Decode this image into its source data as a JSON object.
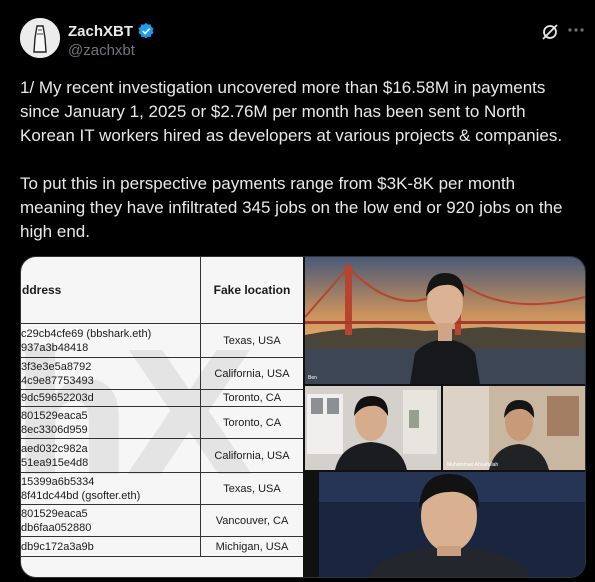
{
  "author": {
    "display_name": "ZachXBT",
    "handle": "@zachxbt",
    "verified": true
  },
  "icons": {
    "verified": "verified-badge-icon",
    "grok": "grok-icon",
    "more": "more-icon"
  },
  "tweet": {
    "paragraph_1": "1/ My recent investigation uncovered more than $16.58M in payments since January 1, 2025 or $2.76M per month has been sent to North Korean IT workers hired as developers at various projects & companies.",
    "paragraph_2": "To put this in perspective payments range from $3K-8K per month meaning they have infiltrated 345 jobs on the low end or 920 jobs on the high end."
  },
  "media": {
    "table": {
      "headers": [
        "ddress",
        "Fake location"
      ],
      "rows": [
        {
          "addr": [
            "c29cb4cfe69 (bbshark.eth)",
            "937a3b48418"
          ],
          "location": "Texas, USA"
        },
        {
          "addr": [
            "3f3e3e5a8792",
            "4c9e87753493"
          ],
          "location": "California, USA"
        },
        {
          "addr": [
            "9dc59652203d"
          ],
          "location": "Toronto, CA"
        },
        {
          "addr": [
            "801529eaca5",
            "8ec3306d959"
          ],
          "location": "Toronto, CA"
        },
        {
          "addr": [
            "aed032c982a",
            "51ea915e4d8"
          ],
          "location": "California, USA"
        },
        {
          "addr": [
            "15399a6b5334",
            "8f41dc44bd (gsofter.eth)"
          ],
          "location": "Texas, USA"
        },
        {
          "addr": [
            "801529eaca5",
            "db6faa052880"
          ],
          "location": "Vancouver, CA"
        },
        {
          "addr": [
            "db9c172a3a9b"
          ],
          "location": "Michigan, USA"
        }
      ],
      "watermark": "hX"
    },
    "camera_labels": {
      "top": "Ben",
      "mid_right": "Muhammad Ahnafullah"
    }
  },
  "colors": {
    "background": "#000000",
    "text_primary": "#e7e9ea",
    "text_secondary": "#71767b",
    "verified_blue": "#1d9bf0"
  }
}
